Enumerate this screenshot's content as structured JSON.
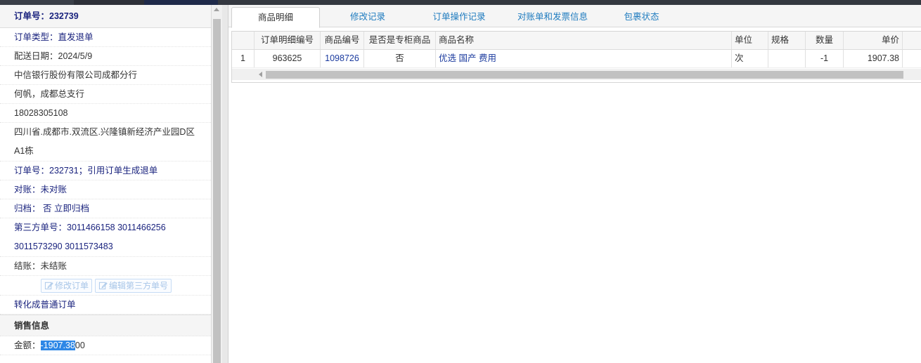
{
  "order_panel": {
    "header": "订单号：232739",
    "rows": {
      "order_type": "订单类型：直发退单",
      "delivery_date": "配送日期：2024/5/9",
      "company": "中信银行股份有限公司成都分行",
      "contact": "何帆，成都总支行",
      "phone": "18028305108",
      "address": "四川省.成都市.双流区.兴隆镇新经济产业园D区A1栋",
      "ref_order": "订单号：232731；引用订单生成退单",
      "reconcile": "对账：未对账",
      "archive": "归档： 否 立即归档",
      "third_party": "第三方单号：3011466158 3011466256 3011573290 3011573483",
      "settle": "结账：未结账"
    },
    "buttons": {
      "edit_order": "修改订单",
      "edit_third_party": "编辑第三方单号"
    },
    "convert_link": "转化成普通订单",
    "sales_section": "销售信息",
    "amount_label": "金额：",
    "amount_selected": "-1907.38",
    "amount_rest": "00"
  },
  "tabs": [
    {
      "label": "商品明细"
    },
    {
      "label": "修改记录"
    },
    {
      "label": "订单操作记录"
    },
    {
      "label": "对账单和发票信息"
    },
    {
      "label": "包裹状态"
    }
  ],
  "table": {
    "columns": [
      "",
      "订单明细编号",
      "商品编号",
      "是否是专柜商品",
      "商品名称",
      "单位",
      "规格",
      "数量",
      "单价"
    ],
    "rows": [
      [
        "1",
        "963625",
        "1098726",
        "否",
        "优选 国产 费用",
        "次",
        "",
        "-1",
        "1907.38"
      ]
    ]
  },
  "colors": {
    "accent_blue": "#1a237e",
    "link_blue": "#1e7bbf",
    "selection": "#2e87e6"
  }
}
